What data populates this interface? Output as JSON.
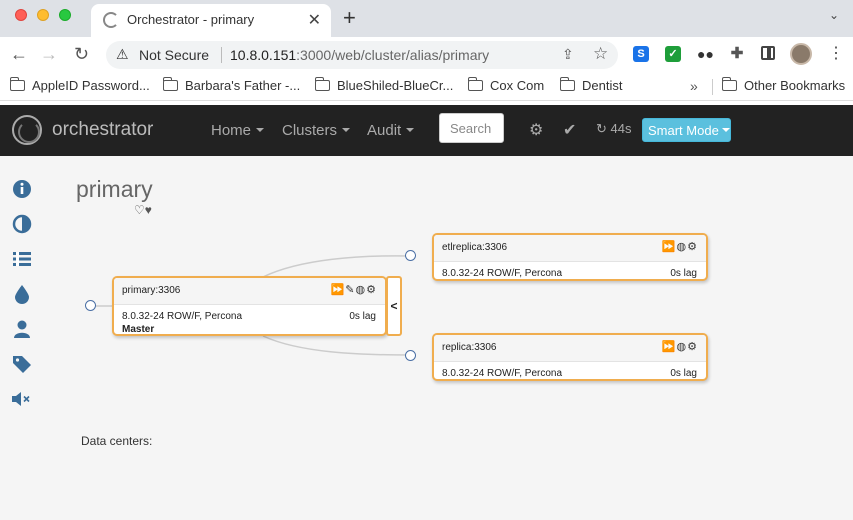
{
  "browser": {
    "tab_title": "Orchestrator - primary",
    "tab_close": "✕",
    "new_tab": "+",
    "tab_menu": "⌄",
    "not_secure": "Not Secure",
    "url_host": "10.8.0.151",
    "url_rest": ":3000/web/cluster/alias/primary",
    "bookmarks": [
      "AppleID Password...",
      "Barbara's Father -...",
      "BlueShiled-BlueCr...",
      "Cox Com",
      "Dentist"
    ],
    "bookmarks_more": "»",
    "other_bookmarks": "Other Bookmarks"
  },
  "navbar": {
    "brand": "orchestrator",
    "home": "Home",
    "clusters": "Clusters",
    "audit": "Audit",
    "search_placeholder": "Search",
    "refresh_countdown": "44s",
    "smart_mode": "Smart Mode"
  },
  "sidebar": {
    "icons": [
      "info-icon",
      "contrast-icon",
      "layers-icon",
      "drop-icon",
      "user-icon",
      "tag-icon",
      "mute-icon"
    ]
  },
  "cluster": {
    "title": "primary",
    "data_centers_label": "Data centers:"
  },
  "nodes": [
    {
      "name": "primary:3306",
      "version": "8.0.32-24 ROW/F, Percona",
      "lag": "0s lag",
      "role": "Master"
    },
    {
      "name": "etlreplica:3306",
      "version": "8.0.32-24 ROW/F, Percona",
      "lag": "0s lag"
    },
    {
      "name": "replica:3306",
      "version": "8.0.32-24 ROW/F, Percona",
      "lag": "0s lag"
    }
  ],
  "colors": {
    "node_border": "#f0ad4e",
    "navbar_bg": "#222222",
    "smart_mode_bg": "#5bc0de",
    "sidebar_icon": "#3a6d99"
  }
}
